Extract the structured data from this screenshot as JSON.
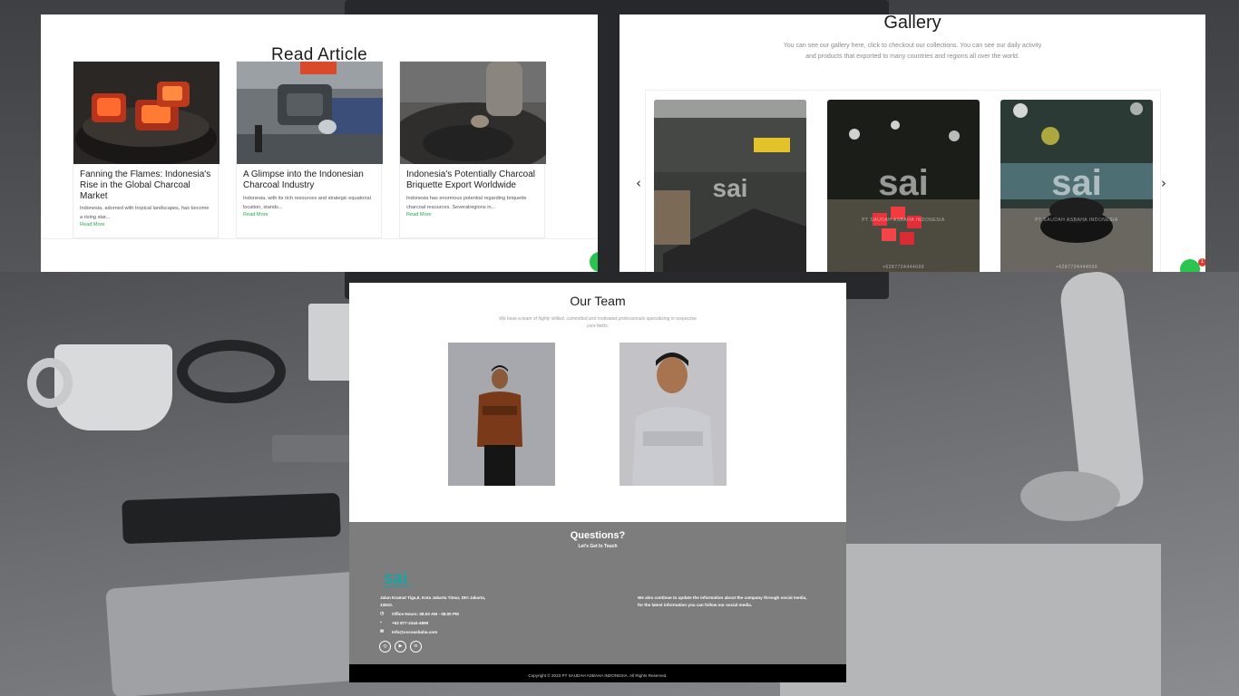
{
  "articles": {
    "title": "Read Article",
    "items": [
      {
        "title": "Fanning the Flames: Indonesia's Rise in the Global Charcoal Market",
        "excerpt": "Indonesia, adorned with tropical landscapes, has become a rising star...",
        "link": "Read More"
      },
      {
        "title": "A Glimpse into the Indonesian Charcoal Industry",
        "excerpt": "Indonesia, with its rich resources and strategic equatorial location, stands...",
        "link": "Read More"
      },
      {
        "title": "Indonesia's Potentially Charcoal Briquette Export Worldwide",
        "excerpt": "Indonesia has enormous potential regarding briquette charcoal resources. Severalregions in...",
        "link": "Read More"
      }
    ]
  },
  "gallery": {
    "title": "Gallery",
    "description": "You can see our gallery here, click to checkout our collections. You can see our daily activity and products that exported to many countries and regions all over the world.",
    "watermark": "sai",
    "watermark_sub": "PT SAUDAH ASBAHA INDONESIA",
    "phone": "+6287724444699",
    "prev_icon": "‹",
    "next_icon": "›"
  },
  "whatsapp": {
    "badge": "1"
  },
  "team": {
    "title": "Our Team",
    "description": "We have a team of highly skilled, committed and motivated professionals specializing in respective core fields."
  },
  "footer": {
    "title": "Questions?",
    "subtitle": "Let's Get In Touch",
    "logo_text": "sai",
    "address": "Jalan Kramat Tiga,II, Kota Jakarta Timur, DKI Jakarta, 13510.",
    "hours": "Office Hours: 08.00 AM - 08.00 PM",
    "phone": "+62 877-2444-4699",
    "email": "Info@cocoasbaha.com",
    "social_note": "We also continue to update the information about the company through social media, for the latest information you can follow our social media.",
    "social": [
      "instagram-icon",
      "youtube-icon",
      "linkedin-icon"
    ],
    "copyright": "Copyright © 2023 PT SAUDAH ASBAHA INDONESIA. All Rights Reserved."
  },
  "colors": {
    "accent_green": "#2aa84a",
    "whatsapp_green": "#2bc44f",
    "logo_teal": "#1aa3a3",
    "footer_bg": "#7d7d7d"
  }
}
